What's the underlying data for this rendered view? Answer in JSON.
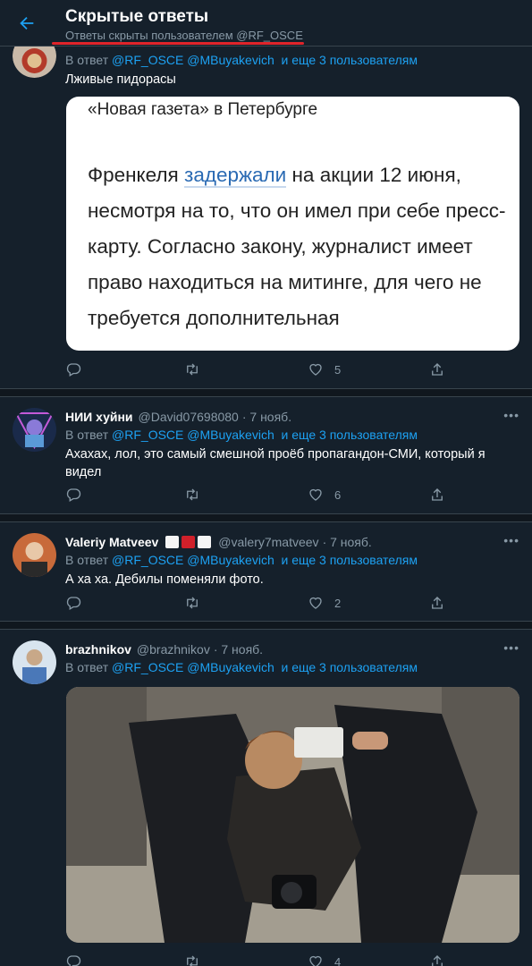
{
  "header": {
    "title": "Скрытые ответы",
    "subtitle": "Ответы скрыты пользователем @RF_OSCE"
  },
  "reply_prefix": "В ответ",
  "reply_mentions": "@RF_OSCE @MBuyakevich",
  "reply_more": "и еще 3 пользователям",
  "tweets": [
    {
      "name": "",
      "handle": "",
      "time": "",
      "text": "Лживые пидорасы",
      "quote": {
        "title": "«Новая газета» в Петербурге",
        "body_before": "Френкеля ",
        "body_link": "задержали",
        "body_after": " на акции 12 июня, несмотря на то, что он имел при себе пресс-карту. Согласно закону, журналист имеет право находиться на митинге, для чего не требуется дополнительная"
      },
      "likes": "5"
    },
    {
      "name": "НИИ хуйни",
      "handle": "@David07698080",
      "time": "· 7 нояб.",
      "text": "Ахахах, лол, это самый смешной проёб пропагандон-СМИ, который я видел",
      "likes": "6"
    },
    {
      "name": "Valeriy Matveev",
      "handle": "@valery7matveev",
      "time": "· 7 нояб.",
      "text": "А ха ха. Дебилы поменяли фото.",
      "likes": "2"
    },
    {
      "name": "brazhnikov",
      "handle": "@brazhnikov",
      "time": "· 7 нояб.",
      "text": "",
      "likes": "4"
    }
  ],
  "colors": {
    "background": "#15202b",
    "separator": "#10171e",
    "border": "#38444d",
    "secondary_text": "#8899a6",
    "accent": "#1da1f2",
    "annotation_red": "#e0242a"
  },
  "icons": {
    "back": "arrow-left-icon",
    "reply": "reply-bubble-icon",
    "retweet": "retweet-icon",
    "like": "heart-icon",
    "share": "share-icon",
    "more": "more-dots-icon"
  }
}
